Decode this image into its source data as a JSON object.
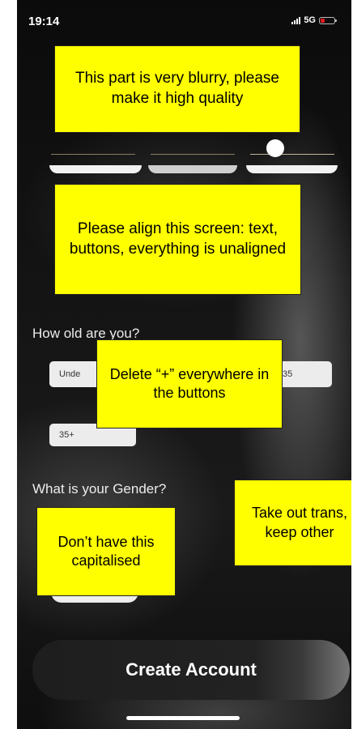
{
  "status": {
    "time": "19:14",
    "network": "5G"
  },
  "notes": {
    "blurry": "This part is very blurry, please make it high quality",
    "align": "Please align this screen: text, buttons, everything is unaligned",
    "plus": "Delete “+” everywhere in the buttons",
    "trans": "Take out trans, keep other",
    "capital": "Don’t have this capitalised"
  },
  "age": {
    "question": "How old are you?",
    "options": [
      "Unde",
      "35",
      "35+"
    ]
  },
  "gender": {
    "question": "What is your Gender?"
  },
  "create_account": "Create Account"
}
